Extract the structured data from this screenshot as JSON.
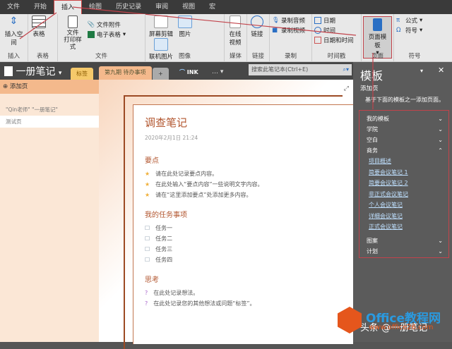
{
  "menu_tabs": [
    "文件",
    "开始",
    "插入",
    "绘图",
    "历史记录",
    "审阅",
    "视图",
    "宏"
  ],
  "ribbon": {
    "insert_space": "插入空间",
    "g_insert": "插入",
    "table": "表格",
    "g_table": "表格",
    "file_printout": "文件\n打印样式",
    "file_attach": "文件附件",
    "spreadsheet": "电子表格",
    "g_file": "文件",
    "screen_clip": "屏幕剪辑",
    "picture": "图片",
    "online_picture": "联机图片",
    "g_image": "图像",
    "online_video": "在线视频",
    "g_media": "媒体",
    "link": "链接",
    "g_link": "链接",
    "record_audio": "录制音频",
    "record_video": "录制视频",
    "g_record": "录制",
    "date": "日期",
    "time": "时间",
    "date_time": "日期和时间",
    "g_timestamp": "时间戳",
    "page_templates": "页面模板",
    "g_pages": "页面",
    "equation": "公式",
    "symbol": "符号",
    "g_symbols": "符号"
  },
  "notebook": {
    "name": "一册笔记",
    "sections": [
      "标签",
      "第九期 待办事项",
      "+"
    ],
    "ink": "INK",
    "search_placeholder": "搜索此笔记本(Ctrl+E)"
  },
  "pages": {
    "add_page": "添加页",
    "items": [
      "\"Qin老师\" \"一册笔记\"",
      "测试页"
    ]
  },
  "note": {
    "title": "调查笔记",
    "date": "2020年2月1日   21:24",
    "headings": [
      "要点",
      "我的任务事项",
      "思考"
    ],
    "points": [
      "请在此处记录要点内容。",
      "在此处输入“要点内容”一些说明文字内容。",
      "请在“这里添加要点”处添加更多内容。"
    ],
    "tasks": [
      "任务一",
      "任务二",
      "任务三",
      "任务四"
    ],
    "thoughts": [
      "在此处记录想法。",
      "在此处记录您的其他想法或问题“标签”。"
    ]
  },
  "templates_pane": {
    "title": "模板",
    "add_page": "添加页",
    "desc": "基于下面的模板之一添加页面。",
    "categories": [
      "我的模板",
      "学院",
      "空白",
      "商务"
    ],
    "business_items": [
      "项目概述",
      "简要会议笔记 1",
      "简要会议笔记 2",
      "非正式会议笔记",
      "个人会议笔记",
      "详细会议笔记",
      "正式会议笔记"
    ],
    "more_categories": [
      "图案",
      "计划"
    ]
  },
  "watermark": {
    "brand": "Office教程网",
    "url": "www.office26.com",
    "caption": "头条 @一册笔记"
  }
}
